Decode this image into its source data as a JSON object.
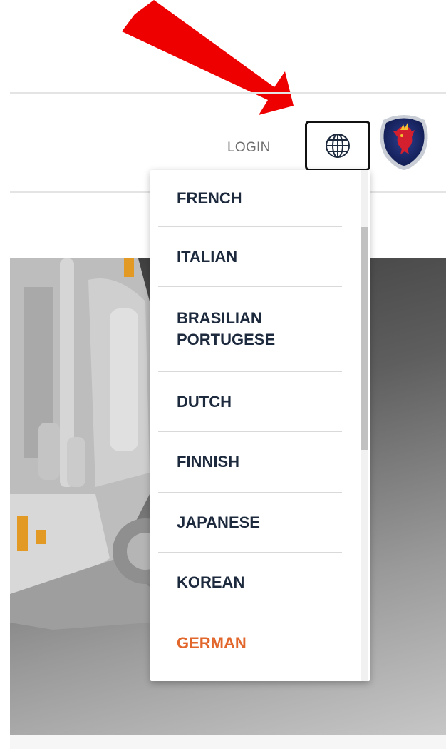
{
  "header": {
    "login_label": "LOGIN",
    "language_button_icon": "globe-icon",
    "logo_icon": "scania-griffin-icon"
  },
  "language_menu": {
    "items": [
      {
        "label": "FRENCH",
        "active": false
      },
      {
        "label": "ITALIAN",
        "active": false
      },
      {
        "label": "BRASILIAN PORTUGESE",
        "active": false
      },
      {
        "label": "DUTCH",
        "active": false
      },
      {
        "label": "FINNISH",
        "active": false
      },
      {
        "label": "JAPANESE",
        "active": false
      },
      {
        "label": "KOREAN",
        "active": false
      },
      {
        "label": "GERMAN",
        "active": true
      }
    ]
  },
  "colors": {
    "active_language": "#e2672d",
    "menu_text": "#1d2a3e",
    "annotation_arrow": "#ee0000"
  },
  "hero": {
    "image_icon": "truck-engine-illustration"
  }
}
